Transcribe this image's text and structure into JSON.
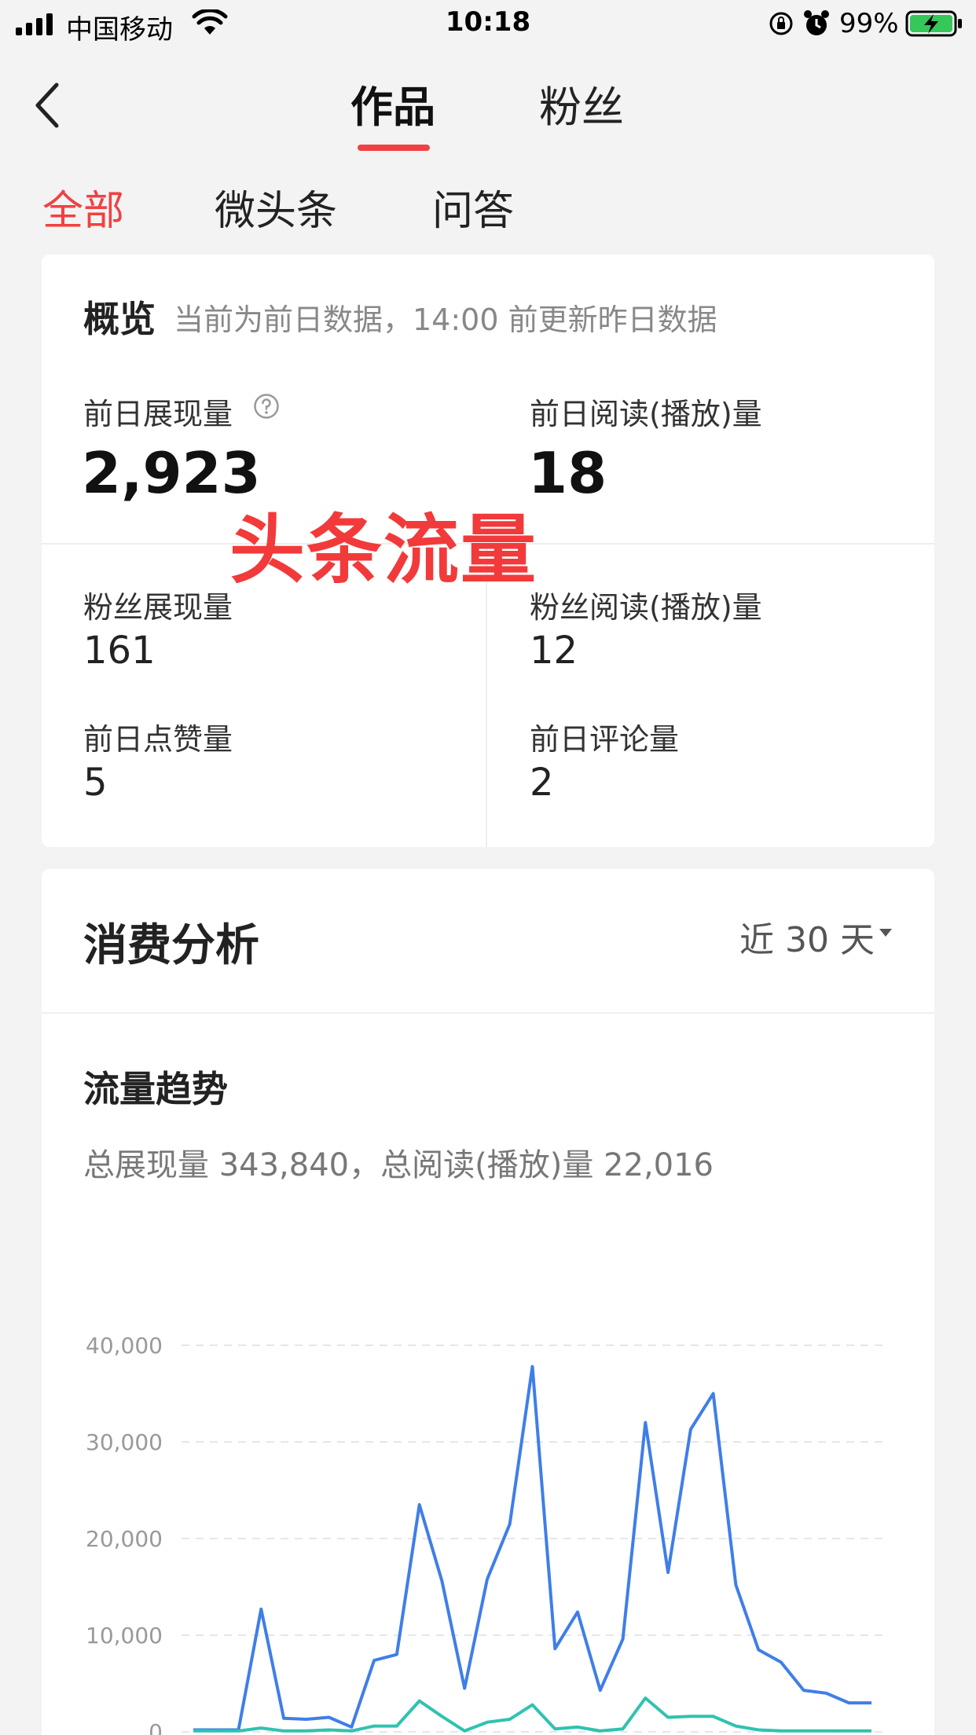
{
  "status_bar": {
    "carrier": "中国移动",
    "time": "10:18",
    "battery_percent": "99%",
    "icons": [
      "signal-icon",
      "wifi-icon",
      "rotation-lock-icon",
      "alarm-icon",
      "battery-charging-icon"
    ]
  },
  "nav": {
    "tabs": [
      {
        "label": "作品",
        "active": true
      },
      {
        "label": "粉丝",
        "active": false
      }
    ],
    "accent_color": "#f04142"
  },
  "sub_tabs": [
    {
      "label": "全部",
      "active": true
    },
    {
      "label": "微头条",
      "active": false
    },
    {
      "label": "问答",
      "active": false
    }
  ],
  "overview": {
    "title": "概览",
    "note": "当前为前日数据，14:00 前更新昨日数据",
    "impressions_label": "前日展现量",
    "impressions_value": "2,923",
    "reads_label": "前日阅读(播放)量",
    "reads_value": "18",
    "fan_impressions_label": "粉丝展现量",
    "fan_impressions_value": "161",
    "fan_reads_label": "粉丝阅读(播放)量",
    "fan_reads_value": "12",
    "likes_label": "前日点赞量",
    "likes_value": "5",
    "comments_label": "前日评论量",
    "comments_value": "2"
  },
  "overlay_text": "头条流量",
  "analysis": {
    "title": "消费分析",
    "period": "近 30 天",
    "trend_title": "流量趋势",
    "summary": "总展现量 343,840，总阅读(播放)量 22,016"
  },
  "chart_data": {
    "type": "line",
    "ylim": [
      0,
      40000
    ],
    "y_ticks": [
      "0",
      "10,000",
      "20,000",
      "30,000",
      "40,000"
    ],
    "grid": true,
    "x": [
      1,
      2,
      3,
      4,
      5,
      6,
      7,
      8,
      9,
      10,
      11,
      12,
      13,
      14,
      15,
      16,
      17,
      18,
      19,
      20,
      21,
      22,
      23,
      24,
      25,
      26,
      27,
      28,
      29,
      30,
      31
    ],
    "series": [
      {
        "color": "#3f7ee8",
        "values": [
          200,
          200,
          200,
          12700,
          1400,
          1300,
          1500,
          500,
          7400,
          8000,
          23500,
          15600,
          4500,
          15800,
          21500,
          37800,
          8600,
          12400,
          4300,
          9600,
          32000,
          16500,
          31300,
          35000,
          15200,
          8500,
          7200,
          4300,
          4000,
          3000,
          3000
        ]
      },
      {
        "color": "#2fc2b1",
        "values": [
          100,
          100,
          100,
          400,
          100,
          100,
          200,
          100,
          600,
          600,
          3200,
          1600,
          100,
          1000,
          1300,
          2800,
          300,
          500,
          100,
          300,
          3500,
          1500,
          1600,
          1600,
          600,
          200,
          100,
          100,
          100,
          100,
          100
        ]
      }
    ]
  }
}
